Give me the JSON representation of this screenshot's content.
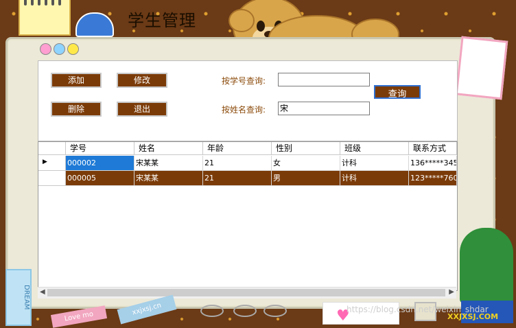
{
  "app": {
    "title": "学生管理"
  },
  "toolbar": {
    "add_label": "添加",
    "edit_label": "修改",
    "delete_label": "删除",
    "exit_label": "退出",
    "query_label": "查询"
  },
  "search": {
    "by_id_label": "按学号查询:",
    "by_id_value": "",
    "by_name_label": "按姓名查询:",
    "by_name_value": "宋"
  },
  "grid": {
    "columns": [
      "学号",
      "姓名",
      "年龄",
      "性别",
      "班级",
      "联系方式"
    ],
    "rows": [
      [
        "000002",
        "宋某某",
        "21",
        "女",
        "计科",
        "136*****345"
      ],
      [
        "000005",
        "宋某某",
        "21",
        "男",
        "计科",
        "123*****760"
      ]
    ],
    "current_row_marker": "▶"
  },
  "stickers": {
    "dream": "DREAM",
    "lovemo": "Love mo",
    "site": "xxjxsj.cn"
  },
  "watermark": "https://blog.csdn.net/weixin_shdar",
  "logo": "XXJXSJ.COM",
  "colors": {
    "accent": "#7b3b08",
    "selected": "#1e7ad6",
    "label": "#8b4a0a"
  }
}
